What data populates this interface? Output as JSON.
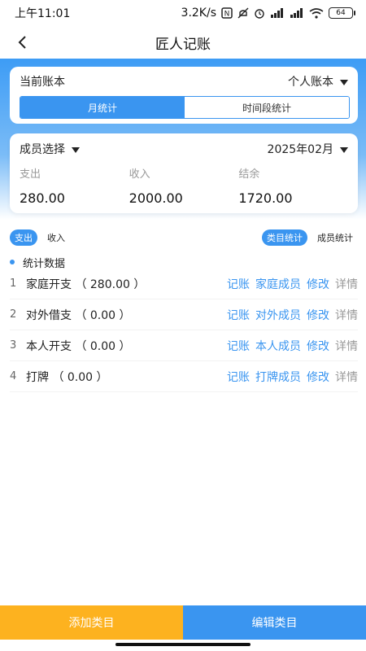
{
  "status": {
    "time": "上午11:01",
    "speed": "3.2K/s",
    "battery": "64"
  },
  "nav": {
    "title": "匠人记账"
  },
  "account": {
    "label": "当前账本",
    "value": "个人账本",
    "tabs": [
      {
        "label": "月统计",
        "active": true
      },
      {
        "label": "时间段统计",
        "active": false
      }
    ]
  },
  "summary": {
    "member_label": "成员选择",
    "month": "2025年02月",
    "stats": [
      {
        "label": "支出",
        "value": "280.00"
      },
      {
        "label": "收入",
        "value": "2000.00"
      },
      {
        "label": "结余",
        "value": "1720.00"
      }
    ]
  },
  "filters": {
    "type": [
      "支出",
      "收入"
    ],
    "mode": [
      "类目统计",
      "成员统计"
    ]
  },
  "section": {
    "title": "统计数据"
  },
  "list": [
    {
      "index": "1",
      "name": "家庭开支 （ 280.00 ）",
      "record": "记账",
      "member": "家庭成员",
      "edit": "修改",
      "detail": "详情"
    },
    {
      "index": "2",
      "name": "对外借支 （ 0.00 ）",
      "record": "记账",
      "member": "对外成员",
      "edit": "修改",
      "detail": "详情"
    },
    {
      "index": "3",
      "name": "本人开支 （ 0.00 ）",
      "record": "记账",
      "member": "本人成员",
      "edit": "修改",
      "detail": "详情"
    },
    {
      "index": "4",
      "name": "打牌 （ 0.00 ）",
      "record": "记账",
      "member": "打牌成员",
      "edit": "修改",
      "detail": "详情"
    }
  ],
  "bottom": {
    "add": "添加类目",
    "edit": "编辑类目"
  },
  "colors": {
    "primary": "#3a95f0",
    "accent": "#fdb21f"
  }
}
